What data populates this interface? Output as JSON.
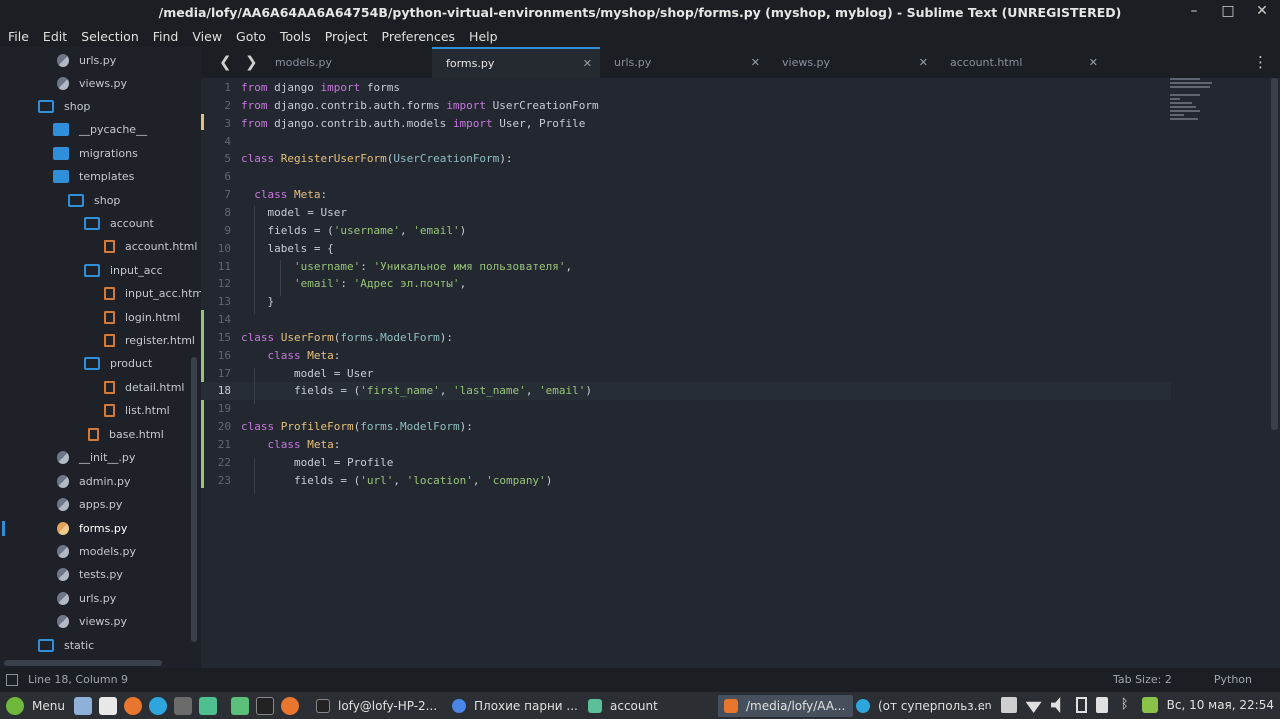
{
  "window": {
    "title": "/media/lofy/AA6A64AA6A64754B/python-virtual-environments/myshop/shop/forms.py (myshop, myblog) - Sublime Text (UNREGISTERED)",
    "minimize": "–",
    "maximize": "□",
    "close": "✕"
  },
  "menu": [
    "File",
    "Edit",
    "Selection",
    "Find",
    "View",
    "Goto",
    "Tools",
    "Project",
    "Preferences",
    "Help"
  ],
  "sidebar": {
    "items": [
      {
        "label": "urls.py",
        "type": "py"
      },
      {
        "label": "views.py",
        "type": "py"
      },
      {
        "label": "shop",
        "type": "folder-open"
      },
      {
        "label": "__pycache__",
        "type": "folder"
      },
      {
        "label": "migrations",
        "type": "folder"
      },
      {
        "label": "templates",
        "type": "folder"
      },
      {
        "label": "shop",
        "type": "folder-open"
      },
      {
        "label": "account",
        "type": "folder-open"
      },
      {
        "label": "account.html",
        "type": "html"
      },
      {
        "label": "input_acc",
        "type": "folder-open"
      },
      {
        "label": "input_acc.htm",
        "type": "html"
      },
      {
        "label": "login.html",
        "type": "html"
      },
      {
        "label": "register.html",
        "type": "html"
      },
      {
        "label": "product",
        "type": "folder-open"
      },
      {
        "label": "detail.html",
        "type": "html"
      },
      {
        "label": "list.html",
        "type": "html"
      },
      {
        "label": "base.html",
        "type": "html"
      },
      {
        "label": "__init__.py",
        "type": "py"
      },
      {
        "label": "admin.py",
        "type": "py"
      },
      {
        "label": "apps.py",
        "type": "py"
      },
      {
        "label": "forms.py",
        "type": "py",
        "active": true
      },
      {
        "label": "models.py",
        "type": "py"
      },
      {
        "label": "tests.py",
        "type": "py"
      },
      {
        "label": "urls.py",
        "type": "py"
      },
      {
        "label": "views.py",
        "type": "py"
      },
      {
        "label": "static",
        "type": "folder-open"
      }
    ]
  },
  "tabs": [
    {
      "label": "models.py",
      "active": false
    },
    {
      "label": "forms.py",
      "active": true
    },
    {
      "label": "urls.py",
      "active": false
    },
    {
      "label": "views.py",
      "active": false
    },
    {
      "label": "account.html",
      "active": false
    }
  ],
  "code": [
    "from django import forms",
    "from django.contrib.auth.forms import UserCreationForm",
    "from django.contrib.auth.models import User, Profile",
    "",
    "class RegisterUserForm(UserCreationForm):",
    "",
    "  class Meta:",
    "    model = User",
    "    fields = ('username', 'email')",
    "    labels = {",
    "        'username': 'Уникальное имя пользователя',",
    "        'email': 'Адрес эл.почты',",
    "    }",
    "",
    "class UserForm(forms.ModelForm):",
    "    class Meta:",
    "        model = User",
    "        fields = ('first_name', 'last_name', 'email')",
    "",
    "class ProfileForm(forms.ModelForm):",
    "    class Meta:",
    "        model = Profile",
    "        fields = ('url', 'location', 'company')"
  ],
  "current_line": 18,
  "status": {
    "position": "Line 18, Column 9",
    "tab_size": "Tab Size: 2",
    "syntax": "Python"
  },
  "taskbar": {
    "menu_label": "Menu",
    "windows": [
      {
        "label": "lofy@lofy-HP-2..."
      },
      {
        "label": "Плохие парни ..."
      },
      {
        "label": "account"
      },
      {
        "label": "/media/lofy/AA..."
      },
      {
        "label": "(от суперпольз..."
      }
    ],
    "lang": "en",
    "clock": "Вс, 10 мая, 22:54"
  },
  "colors": {
    "accent": "#2f8fd8",
    "keyword": "#c678dd",
    "class_name": "#e5c07b",
    "string": "#98c379"
  }
}
